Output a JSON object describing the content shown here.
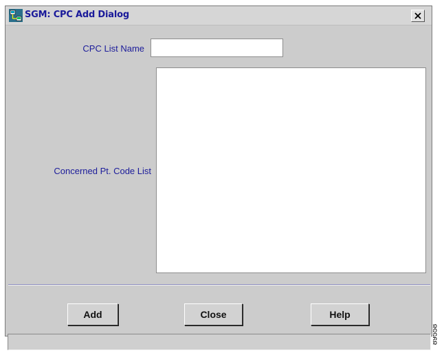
{
  "window": {
    "title": "SGM: CPC Add Dialog",
    "close_glyph": "×",
    "app_icon": "network-app-icon"
  },
  "form": {
    "list_name_label": "CPC List Name",
    "list_name_value": "",
    "code_list_label": "Concerned Pt. Code List",
    "code_list_value": ""
  },
  "buttons": {
    "add": "Add",
    "close": "Close",
    "help": "Help"
  },
  "status": {
    "text": ""
  },
  "figure_code": "89558",
  "colors": {
    "label": "#1b1b9a",
    "title": "#1a1a9a",
    "background": "#cccccc",
    "divider": "#8e8ec0"
  }
}
